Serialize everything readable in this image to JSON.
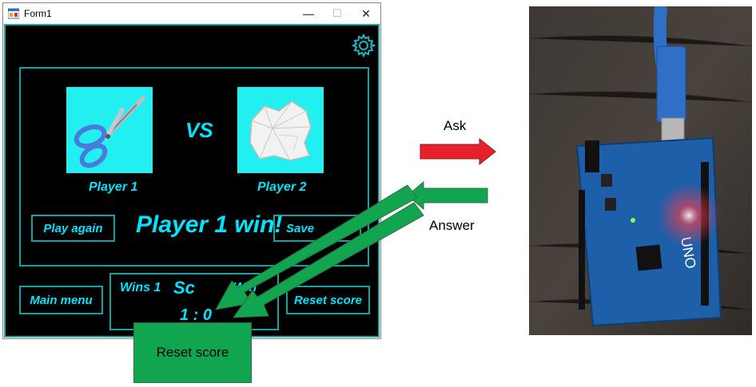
{
  "window": {
    "title": "Form1",
    "minimize_symbol": "—",
    "maximize_symbol": "☐",
    "close_symbol": "✕",
    "icon": "form-app-icon"
  },
  "game": {
    "settings_icon": "gear-icon",
    "vs_label": "VS",
    "player1": {
      "label": "Player 1",
      "choice_icon": "scissors-icon"
    },
    "player2": {
      "label": "Player 2",
      "choice_icon": "crumpled-paper-icon"
    },
    "result_text": "Player 1 win!",
    "play_again_label": "Play again",
    "save_label": "Save",
    "main_menu_label": "Main menu",
    "reset_score_label": "Reset score",
    "score": {
      "wins1_label": "Wins 1",
      "title": "Sc",
      "wins2_label": "Win",
      "value": "1 : 0"
    }
  },
  "annotations": {
    "ask_label": "Ask",
    "answer_label": "Answer",
    "reset_box_label": "Reset score",
    "ask_arrow_color": "#e8202a",
    "answer_arrow_color": "#12a550"
  },
  "colors": {
    "neon": "#00e5ff",
    "panel_border": "#13a3a3",
    "player_tile": "#22f0f0",
    "form_background": "#000000"
  }
}
